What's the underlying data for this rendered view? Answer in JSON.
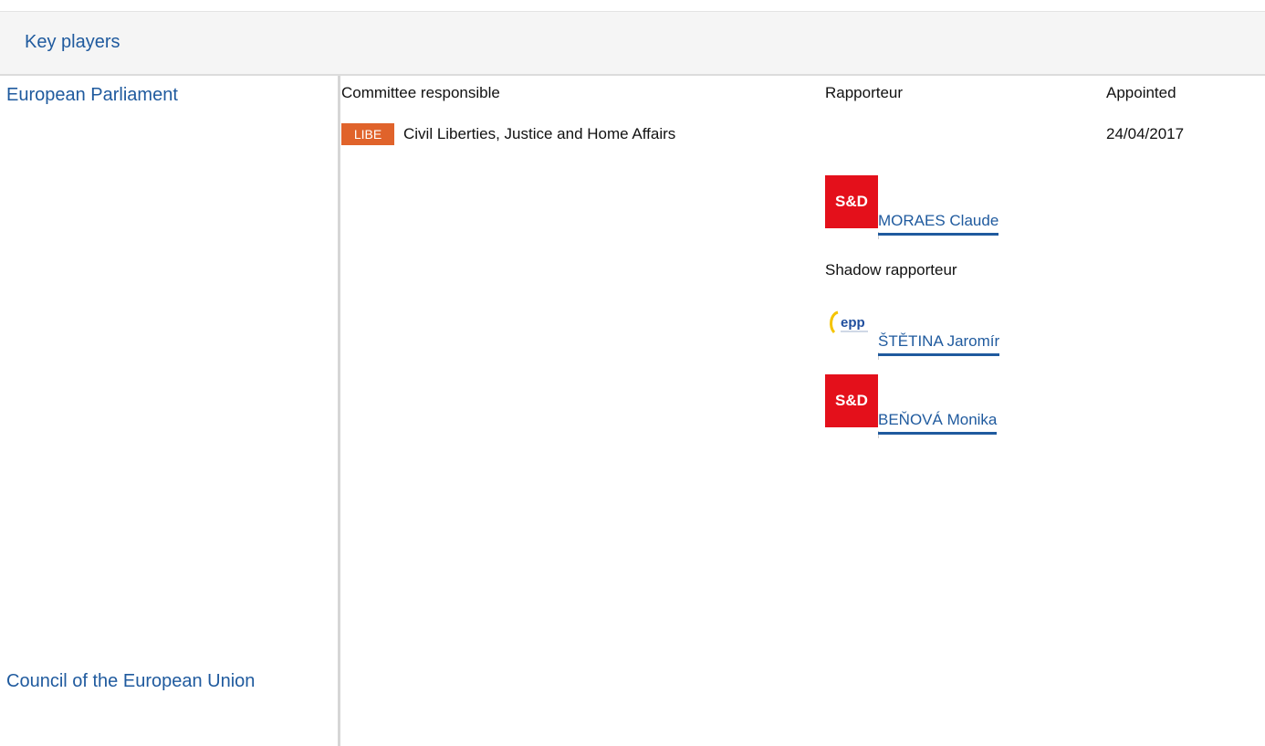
{
  "section_title": "Key players",
  "institutions": {
    "ep": "European Parliament",
    "council": "Council of the European Union"
  },
  "columns": {
    "committee": "Committee responsible",
    "rapporteur": "Rapporteur",
    "appointed": "Appointed"
  },
  "committee": {
    "code": "LIBE",
    "name": "Civil Liberties, Justice and Home Affairs",
    "appointed": "24/04/2017"
  },
  "rapporteur": {
    "group_logo": "S&D",
    "name": "MORAES Claude"
  },
  "shadow_label": "Shadow rapporteur",
  "shadows": [
    {
      "group_logo": "epp",
      "name": "ŠTĚTINA Jaromír"
    },
    {
      "group_logo": "S&D",
      "name": "BEŇOVÁ Monika"
    }
  ],
  "colors": {
    "link": "#1f5a9e",
    "badge": "#e0632b",
    "sd_red": "#e4101b"
  }
}
